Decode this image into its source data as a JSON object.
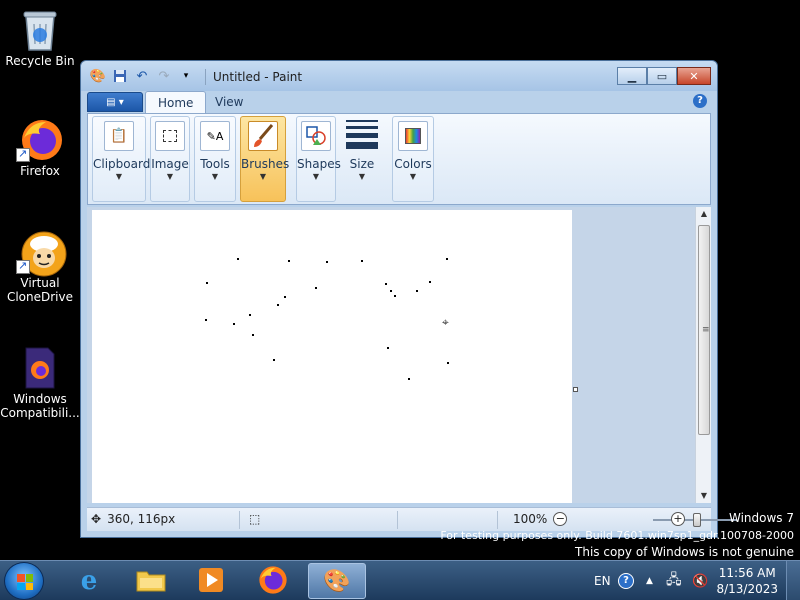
{
  "desktop": {
    "icons": [
      {
        "label": "Recycle Bin"
      },
      {
        "label": "Firefox"
      },
      {
        "label": "Virtual CloneDrive"
      },
      {
        "label": "Windows Compatibili..."
      }
    ]
  },
  "window": {
    "title": "Untitled - Paint",
    "tabs": {
      "home": "Home",
      "view": "View"
    },
    "ribbon": {
      "clipboard": "Clipboard",
      "image": "Image",
      "tools": "Tools",
      "brushes": "Brushes",
      "shapes": "Shapes",
      "size": "Size",
      "colors": "Colors"
    },
    "status": {
      "cursor_position": "360, 116px",
      "zoom": "100%"
    }
  },
  "watermark": {
    "line1": "Windows 7",
    "line2": "For testing purposes only. Build 7601.win7sp1_gdr.100708-2000",
    "line3": "This copy of Windows is not genuine"
  },
  "taskbar": {
    "language": "EN",
    "time": "11:56 AM",
    "date": "8/13/2023"
  },
  "colors": {
    "accent": "#1c57a8",
    "selected_group": "#f7c25a"
  }
}
